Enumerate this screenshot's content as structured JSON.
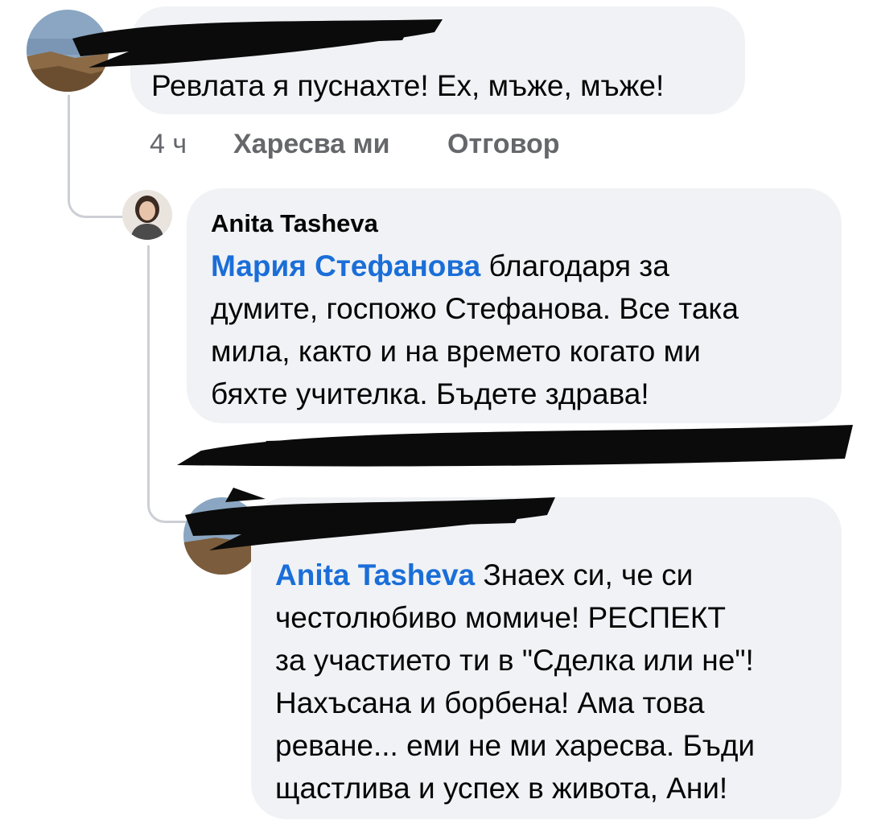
{
  "comment1": {
    "author": "",
    "text": "Ревлата я пуснахте! Ех, мъже, мъже!",
    "time": "4 ч",
    "like_label": "Харесва ми",
    "reply_label": "Отговор"
  },
  "reply1": {
    "author": "Anita Tasheva",
    "mention": "Мария Стефанова",
    "text_lines": [
      " благодаря за",
      "думите, госпожо Стефанова. Все така",
      "мила, както и на времето когато ми",
      "бяхте учителка. Бъдете здрава!"
    ]
  },
  "reply2": {
    "author": "",
    "mention": "Anita Tasheva",
    "text_lines": [
      " Знаех си, че си",
      "честолюбиво момиче! РЕСПЕКТ",
      "за участието ти в \"Сделка или не\"!",
      "Нахъсана и борбена! Ама това",
      "реване... еми не ми харесва. Бъди",
      "щастлива и успех в живота, Ани!"
    ]
  },
  "colors": {
    "bubble": "#f0f2f5",
    "mention": "#1a6ed8",
    "meta": "#65676b",
    "thread_line": "#ccd0d5",
    "redaction": "#0b0b0b"
  }
}
